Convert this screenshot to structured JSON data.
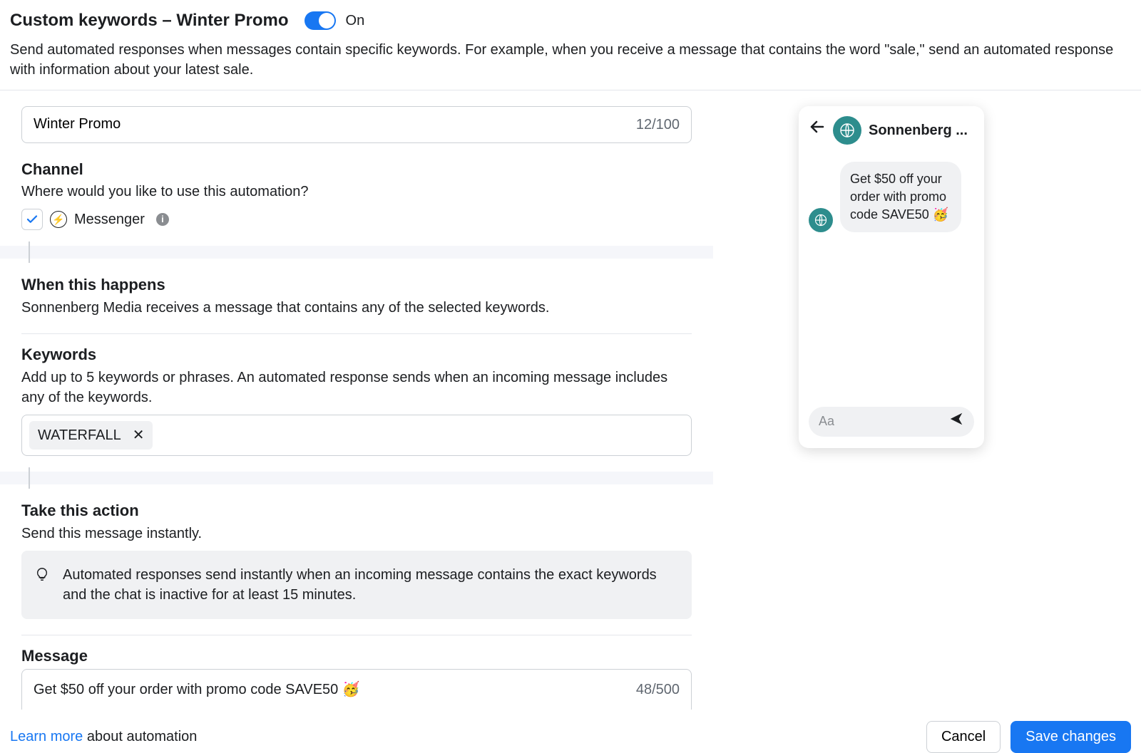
{
  "header": {
    "title": "Custom keywords – Winter Promo",
    "toggle_state": "On",
    "subtitle": "Send automated responses when messages contain specific keywords. For example, when you receive a message that contains the word \"sale,\" send an automated response with information about your latest sale."
  },
  "name": {
    "value": "Winter Promo",
    "counter": "12/100"
  },
  "channel": {
    "label": "Channel",
    "sublabel": "Where would you like to use this automation?",
    "option": "Messenger"
  },
  "trigger": {
    "label": "When this happens",
    "sublabel": "Sonnenberg Media receives a message that contains any of the selected keywords."
  },
  "keywords": {
    "label": "Keywords",
    "sublabel": "Add up to 5 keywords or phrases. An automated response sends when an incoming message includes any of the keywords.",
    "chips": [
      "WATERFALL"
    ]
  },
  "action": {
    "label": "Take this action",
    "sublabel": "Send this message instantly.",
    "banner": "Automated responses send instantly when an incoming message contains the exact keywords and the chat is inactive for at least 15 minutes."
  },
  "message": {
    "label": "Message",
    "text": "Get $50 off your order with promo code SAVE50 🥳",
    "counter": "48/500"
  },
  "preview": {
    "page_name": "Sonnenberg ...",
    "bubble": "Get $50 off your order with promo code SAVE50 🥳",
    "placeholder": "Aa"
  },
  "footer": {
    "learn_more": "Learn more",
    "about": " about automation",
    "cancel": "Cancel",
    "save": "Save changes"
  }
}
